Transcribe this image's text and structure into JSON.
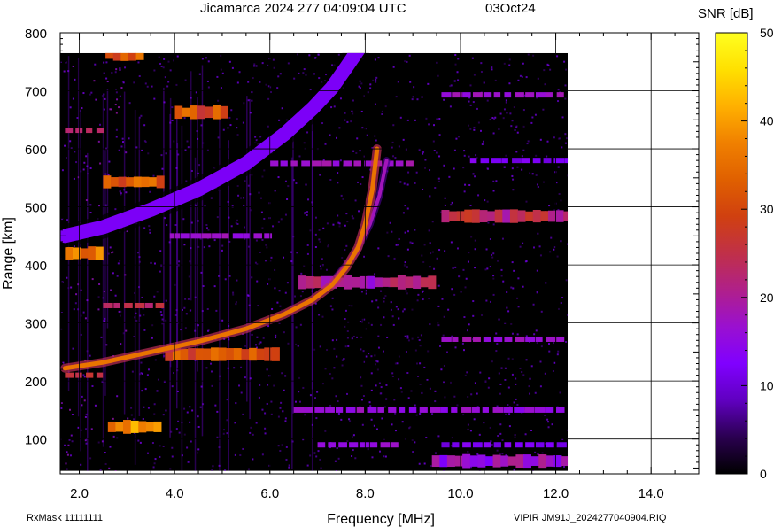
{
  "chart_data": {
    "type": "heatmap",
    "title_left": "Jicamarca 2024 277 04:09:04 UTC",
    "title_right": "03Oct24",
    "xlabel": "Frequency [MHz]",
    "ylabel": "Range [km]",
    "xlim": [
      1.6,
      15.0
    ],
    "ylim": [
      40,
      800
    ],
    "xticks": [
      2.0,
      4.0,
      6.0,
      8.0,
      10.0,
      12.0,
      14.0
    ],
    "xtick_labels": [
      "2.0",
      "4.0",
      "6.0",
      "8.0",
      "10.0",
      "12.0",
      "14.0"
    ],
    "yticks": [
      100,
      200,
      300,
      400,
      500,
      600,
      700,
      800
    ],
    "ytick_labels": [
      "100",
      "200",
      "300",
      "400",
      "500",
      "600",
      "700",
      "800"
    ],
    "data_extent": {
      "freq_max": 12.25,
      "range_min": 45,
      "range_max": 765
    },
    "grid": true,
    "colorbar": {
      "label": "SNR [dB]",
      "min": 0,
      "max": 50,
      "ticks": [
        0,
        10,
        20,
        30,
        40,
        50
      ],
      "tick_labels": [
        "0",
        "10",
        "20",
        "30",
        "40",
        "50"
      ],
      "colors": [
        "#000000",
        "#2a0050",
        "#6000c0",
        "#8000ff",
        "#9a10d0",
        "#b0208a",
        "#c03048",
        "#d04010",
        "#e06000",
        "#f08000",
        "#ffb000",
        "#ffe000",
        "#ffff20"
      ]
    },
    "traces": {
      "o_mode": {
        "f": [
          1.7,
          2.5,
          3.5,
          4.5,
          5.5,
          6.3,
          6.9,
          7.3,
          7.6,
          7.85,
          8.0,
          8.15,
          8.25
        ],
        "r": [
          222,
          232,
          250,
          268,
          290,
          315,
          340,
          365,
          395,
          430,
          470,
          530,
          600
        ],
        "snr": 36
      },
      "x_mode": {
        "f": [
          7.4,
          7.8,
          8.1,
          8.3,
          8.45
        ],
        "r": [
          380,
          420,
          470,
          520,
          580
        ],
        "snr": 18
      },
      "upper_echo": {
        "f": [
          1.7,
          2.5,
          3.5,
          4.5,
          5.5,
          6.3,
          6.9,
          7.3,
          7.6,
          7.85
        ],
        "r": [
          450,
          465,
          495,
          530,
          575,
          625,
          670,
          705,
          740,
          770
        ],
        "snr": 12
      }
    },
    "interference": [
      {
        "f0": 2.55,
        "f1": 3.35,
        "r": 763,
        "snr": 33
      },
      {
        "f0": 4.0,
        "f1": 5.05,
        "r": 663,
        "snr": 32
      },
      {
        "f0": 2.5,
        "f1": 3.7,
        "r": 543,
        "snr": 33
      },
      {
        "f0": 1.7,
        "f1": 2.45,
        "r": 420,
        "snr": 36
      },
      {
        "f0": 6.6,
        "f1": 9.4,
        "r": 370,
        "snr": 21
      },
      {
        "f0": 3.8,
        "f1": 6.1,
        "r": 246,
        "snr": 32
      },
      {
        "f0": 2.6,
        "f1": 3.7,
        "r": 121,
        "snr": 39
      },
      {
        "f0": 9.6,
        "f1": 12.2,
        "r": 484,
        "snr": 24
      },
      {
        "f0": 9.4,
        "f1": 12.2,
        "r": 62,
        "snr": 17
      }
    ],
    "lines": [
      {
        "f0": 6.0,
        "f1": 9.0,
        "r": 575,
        "snr": 15
      },
      {
        "f0": 3.9,
        "f1": 5.9,
        "r": 450,
        "snr": 15
      },
      {
        "f0": 2.5,
        "f1": 3.7,
        "r": 330,
        "snr": 22
      },
      {
        "f0": 1.7,
        "f1": 2.4,
        "r": 632,
        "snr": 22
      },
      {
        "f0": 1.7,
        "f1": 2.4,
        "r": 210,
        "snr": 24
      },
      {
        "f0": 9.6,
        "f1": 12.2,
        "r": 693,
        "snr": 15
      },
      {
        "f0": 9.6,
        "f1": 12.2,
        "r": 272,
        "snr": 15
      },
      {
        "f0": 6.5,
        "f1": 12.2,
        "r": 150,
        "snr": 14
      },
      {
        "f0": 7.0,
        "f1": 8.6,
        "r": 90,
        "snr": 14
      },
      {
        "f0": 9.6,
        "f1": 12.2,
        "r": 90,
        "snr": 10
      },
      {
        "f0": 10.2,
        "f1": 12.2,
        "r": 580,
        "snr": 10
      }
    ]
  },
  "footer": {
    "rxmask": "RxMask 11111111",
    "file": "VIPIR  JM91J_2024277040904.RIQ"
  }
}
